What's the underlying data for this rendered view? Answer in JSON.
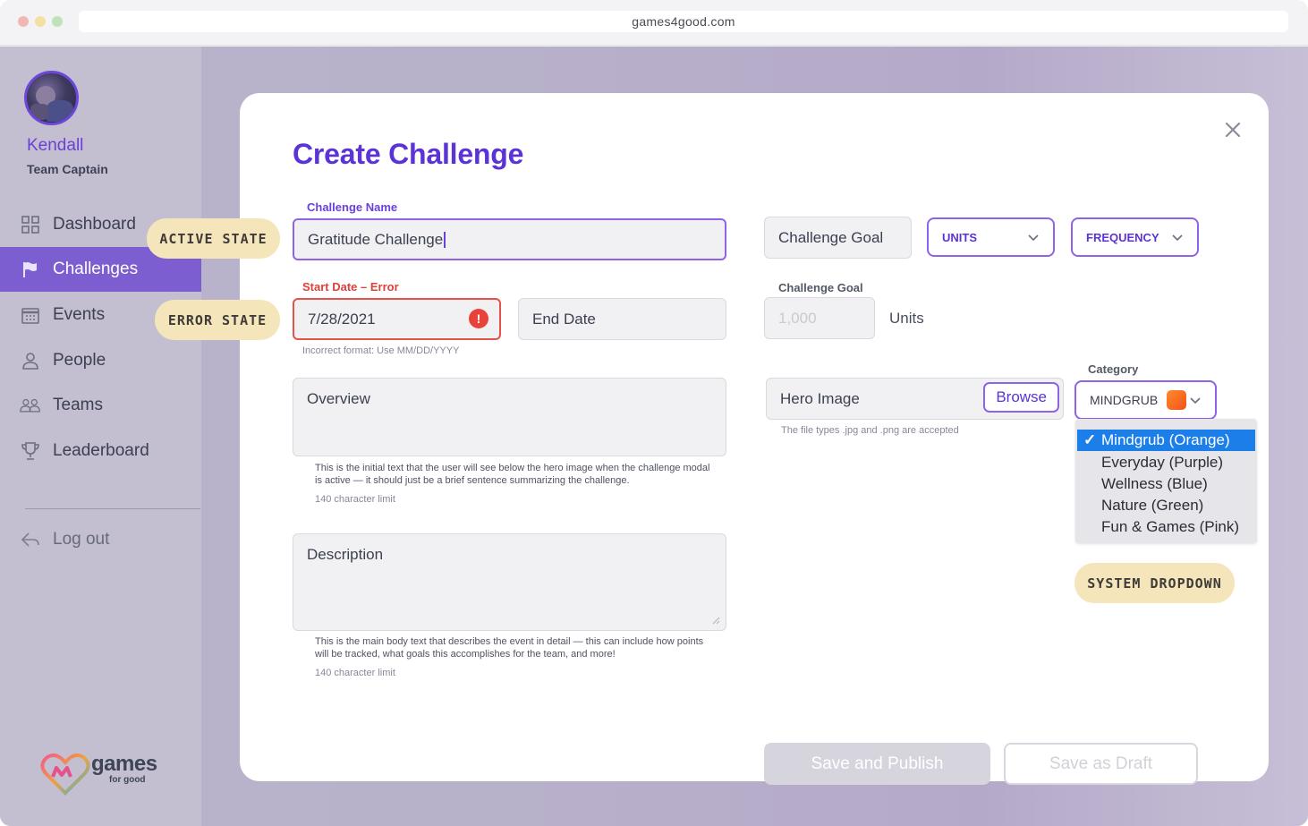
{
  "browser": {
    "url": "games4good.com"
  },
  "user": {
    "name": "Kendall",
    "role": "Team Captain"
  },
  "nav": {
    "items": [
      {
        "label": "Dashboard",
        "icon": "grid-icon"
      },
      {
        "label": "Challenges",
        "icon": "flag-icon",
        "active": true
      },
      {
        "label": "Events",
        "icon": "calendar-icon"
      },
      {
        "label": "People",
        "icon": "person-icon"
      },
      {
        "label": "Teams",
        "icon": "people-group-icon"
      },
      {
        "label": "Leaderboard",
        "icon": "trophy-icon"
      }
    ],
    "logout": "Log out"
  },
  "logo": {
    "text": "games",
    "subtext": "for good"
  },
  "callouts": {
    "active": "ACTIVE STATE",
    "error": "ERROR STATE",
    "system": "SYSTEM DROPDOWN"
  },
  "modal": {
    "title": "Create Challenge",
    "challenge_name": {
      "label": "Challenge Name",
      "value": "Gratitude Challenge"
    },
    "start_date": {
      "label": "Start Date – Error",
      "value": "7/28/2021",
      "error": "Incorrect format: Use MM/DD/YYYY"
    },
    "end_date": {
      "placeholder": "End Date"
    },
    "overview": {
      "placeholder": "Overview",
      "help": "This is the initial text that the user will see below the hero image when the challenge modal is active — it should just be a brief sentence summarizing the challenge.",
      "limit": "140 character limit"
    },
    "description": {
      "placeholder": "Description",
      "help": "This is the main body text that describes the event in detail — this can include how points will be tracked, what goals this accomplishes for the team, and more!",
      "limit": "140 character limit"
    },
    "goal_field": {
      "placeholder": "Challenge Goal"
    },
    "units_dropdown": "UNITS",
    "frequency_dropdown": "FREQUENCY",
    "goal_number": {
      "label": "Challenge Goal",
      "placeholder": "1,000",
      "units": "Units"
    },
    "hero_image": {
      "placeholder": "Hero Image",
      "browse": "Browse",
      "help": "The file types .jpg and .png are accepted"
    },
    "category": {
      "label": "Category",
      "selected": "MINDGRUB",
      "swatch_color": "#f46a22",
      "options": [
        "Mindgrub (Orange)",
        "Everyday (Purple)",
        "Wellness (Blue)",
        "Nature (Green)",
        "Fun & Games (Pink)"
      ]
    },
    "buttons": {
      "publish": "Save and Publish",
      "draft": "Save as Draft"
    }
  },
  "colors": {
    "accent": "#5b33d6",
    "error": "#e4524a",
    "nav_active": "#7c5ed1",
    "callout": "#f4e5ba",
    "system_select": "#1c7ee8"
  }
}
